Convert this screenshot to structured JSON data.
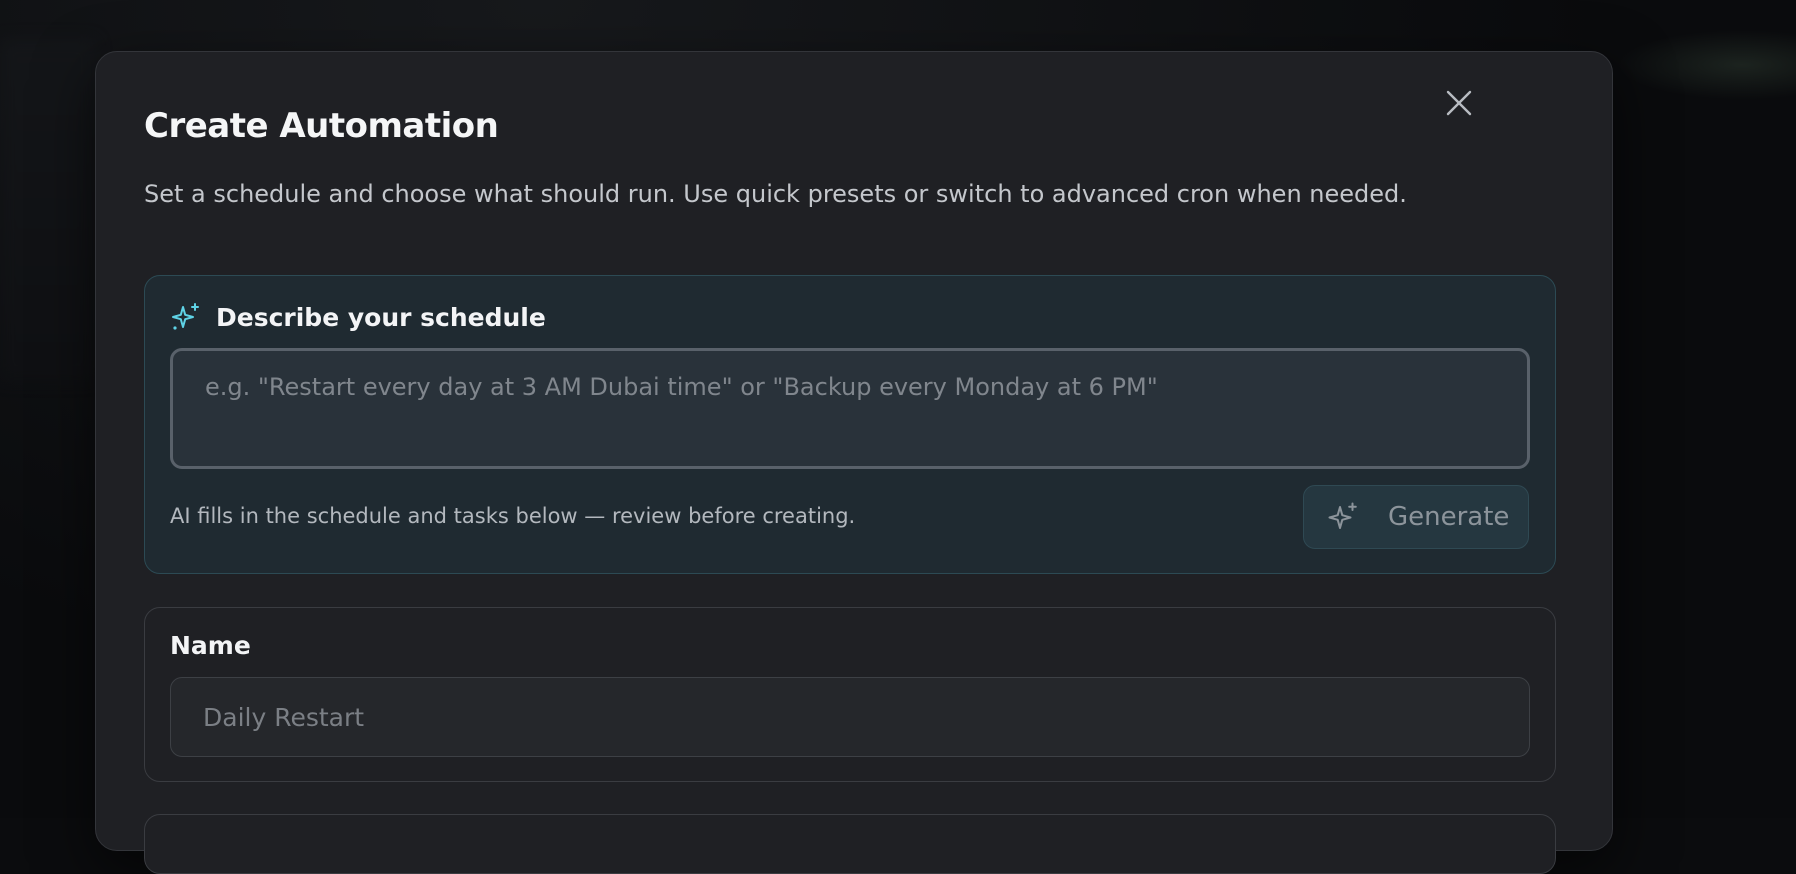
{
  "modal": {
    "title": "Create Automation",
    "subtitle": "Set a schedule and choose what should run. Use quick presets or switch to advanced cron when needed.",
    "close_icon": "close-icon"
  },
  "ai_section": {
    "label": "Describe your schedule",
    "icon": "sparkles-icon",
    "input_value": "",
    "input_placeholder": "e.g. \"Restart every day at 3 AM Dubai time\" or \"Backup every Monday at 6 PM\"",
    "hint": "AI fills in the schedule and tasks below — review before creating.",
    "generate_label": "Generate",
    "generate_icon": "sparkles-icon",
    "accent_color": "#5fd3e6"
  },
  "name_section": {
    "label": "Name",
    "input_value": "",
    "input_placeholder": "Daily Restart"
  }
}
